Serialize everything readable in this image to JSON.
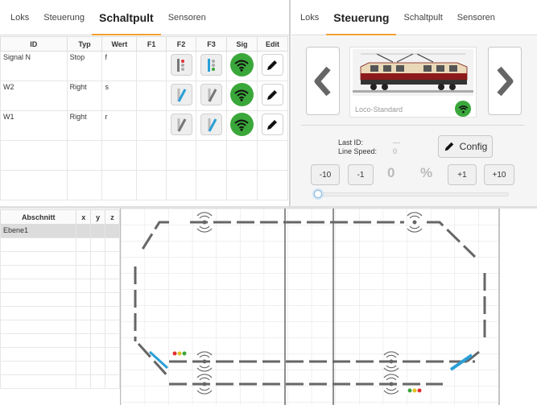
{
  "left_tabs": {
    "items": [
      {
        "label": "Loks"
      },
      {
        "label": "Steuerung"
      },
      {
        "label": "Schaltpult",
        "active": true
      },
      {
        "label": "Sensoren"
      }
    ]
  },
  "right_tabs": {
    "items": [
      {
        "label": "Loks"
      },
      {
        "label": "Steuerung",
        "active": true
      },
      {
        "label": "Schaltpult"
      },
      {
        "label": "Sensoren"
      }
    ]
  },
  "schaltpult_table": {
    "headers": [
      "ID",
      "Typ",
      "Wert",
      "F1",
      "F2",
      "F3",
      "Sig",
      "Edit"
    ],
    "rows": [
      {
        "id": "Signal N",
        "typ": "Stop",
        "wert": "f",
        "f2_icon": "signal-red-icon",
        "f3_icon": "signal-green-icon"
      },
      {
        "id": "W2",
        "typ": "Right",
        "wert": "s",
        "f2_icon": "switch-straight-active-icon",
        "f3_icon": "switch-diverge-inactive-icon"
      },
      {
        "id": "W1",
        "typ": "Right",
        "wert": "r",
        "f2_icon": "switch-straight-inactive-icon",
        "f3_icon": "switch-diverge-active-icon"
      }
    ],
    "sig_icon": "wifi-icon",
    "edit_icon": "pencil-icon"
  },
  "steuerung": {
    "loco_name": "Loco-Standard",
    "last_id_label": "Last ID:",
    "last_id_value": "---",
    "line_speed_label": "Line Speed:",
    "line_speed_value": "0",
    "config_label": "Config",
    "speed_value": "0",
    "percent": "%",
    "buttons": [
      "-10",
      "-1",
      "+1",
      "+10"
    ],
    "slider_fraction": 0.0
  },
  "abschnitt_table": {
    "headers": [
      "Abschnitt",
      "x",
      "y",
      "z"
    ],
    "rows": [
      {
        "name": "Ebene1",
        "x": "",
        "y": "",
        "z": ""
      }
    ]
  },
  "colors": {
    "accent": "#f0a030",
    "signal_green": "#3aa73a",
    "track": "#606060",
    "switch_blue": "#2a9fd6"
  }
}
